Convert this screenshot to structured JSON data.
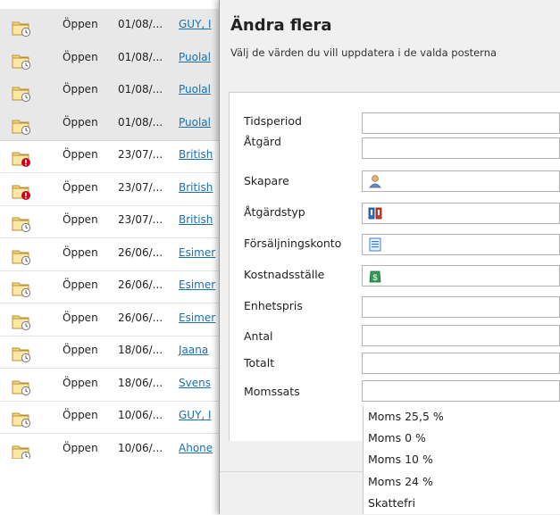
{
  "list": {
    "rows": [
      {
        "status": "Öppen",
        "date": "01/08/...",
        "name": "GUY, I",
        "name_underlined": true,
        "icon": "folder-clock-icon",
        "selected": true
      },
      {
        "status": "Öppen",
        "date": "01/08/...",
        "name": "Puolal",
        "icon": "folder-clock-icon",
        "selected": true
      },
      {
        "status": "Öppen",
        "date": "01/08/...",
        "name": "Puolal",
        "icon": "folder-clock-icon",
        "selected": true
      },
      {
        "status": "Öppen",
        "date": "01/08/...",
        "name": "Puolal",
        "icon": "folder-clock-icon",
        "selected": true
      },
      {
        "status": "Öppen",
        "date": "23/07/...",
        "name": "British",
        "icon": "folder-alert-icon",
        "selected": false
      },
      {
        "status": "Öppen",
        "date": "23/07/...",
        "name": "British",
        "icon": "folder-alert-icon",
        "selected": false
      },
      {
        "status": "Öppen",
        "date": "23/07/...",
        "name": "British",
        "icon": "folder-clock-icon",
        "selected": false
      },
      {
        "status": "Öppen",
        "date": "26/06/...",
        "name": "Esimer",
        "icon": "folder-clock-icon",
        "selected": false
      },
      {
        "status": "Öppen",
        "date": "26/06/...",
        "name": "Esimer",
        "icon": "folder-clock-icon",
        "selected": false
      },
      {
        "status": "Öppen",
        "date": "26/06/...",
        "name": "Esimer",
        "icon": "folder-clock-icon",
        "selected": false
      },
      {
        "status": "Öppen",
        "date": "18/06/...",
        "name": "Jaana",
        "icon": "folder-clock-icon",
        "selected": false
      },
      {
        "status": "Öppen",
        "date": "18/06/...",
        "name": "Svens",
        "icon": "folder-clock-icon",
        "selected": false
      },
      {
        "status": "Öppen",
        "date": "10/06/...",
        "name": "GUY, I",
        "icon": "folder-clock-icon",
        "selected": false
      },
      {
        "status": "Öppen",
        "date": "10/06/...",
        "name": "Ahone",
        "icon": "folder-clock-icon",
        "selected": false
      }
    ]
  },
  "panel": {
    "title": "Ändra flera",
    "subtitle": "Välj de värden du vill uppdatera i de valda posterna",
    "fields": [
      {
        "label": "Tidsperiod",
        "icon": null
      },
      {
        "label": "Åtgärd",
        "icon": null
      },
      {
        "label": "Skapare",
        "icon": "person-icon"
      },
      {
        "label": "Åtgärdstyp",
        "icon": "action-type-icon"
      },
      {
        "label": "Försäljningskonto",
        "icon": "document-list-icon"
      },
      {
        "label": "Kostnadsställe",
        "icon": "money-bag-icon"
      },
      {
        "label": "Enhetspris",
        "icon": null
      },
      {
        "label": "Antal",
        "icon": null
      },
      {
        "label": "Totalt",
        "icon": null
      },
      {
        "label": "Momssats",
        "icon": null
      }
    ],
    "vat_dropdown": {
      "options": [
        "Moms 25,5 %",
        "Moms 0 %",
        "Moms 10 %",
        "Moms 24 %",
        "Skattefri"
      ]
    }
  },
  "colors": {
    "link": "#1a6fb0",
    "selected_row": "#e8e8e8",
    "panel_bg": "#f0f0f0",
    "alert_red": "#d0021b",
    "folder_yellow": "#f2c94c"
  }
}
